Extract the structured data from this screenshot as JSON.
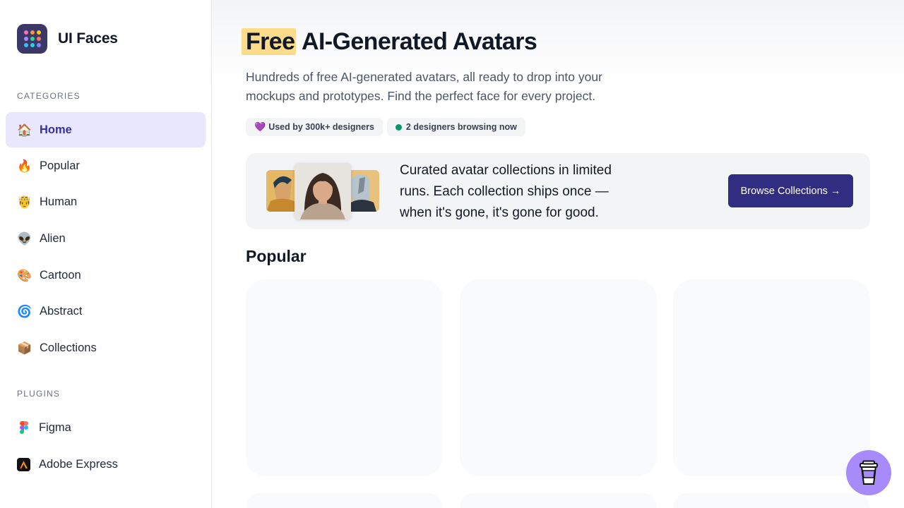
{
  "brand": {
    "name": "UI Faces",
    "logo_dots": [
      "#f472b6",
      "#fb923c",
      "#facc15",
      "#a78bfa",
      "#34d399",
      "#f87171",
      "#38bdf8",
      "#22d3ee",
      "#818cf8"
    ]
  },
  "sidebar": {
    "categories_title": "CATEGORIES",
    "items": [
      {
        "label": "Home",
        "icon": "house-emoji",
        "glyph": "🏠",
        "active": true
      },
      {
        "label": "Popular",
        "icon": "fire-emoji",
        "glyph": "🔥",
        "active": false
      },
      {
        "label": "Human",
        "icon": "face-emoji",
        "glyph": "🤴",
        "active": false
      },
      {
        "label": "Alien",
        "icon": "alien-emoji",
        "glyph": "👽",
        "active": false
      },
      {
        "label": "Cartoon",
        "icon": "palette-emoji",
        "glyph": "🎨",
        "active": false
      },
      {
        "label": "Abstract",
        "icon": "cyclone-emoji",
        "glyph": "🌀",
        "active": false
      },
      {
        "label": "Collections",
        "icon": "package-emoji",
        "glyph": "📦",
        "active": false
      }
    ],
    "plugins_title": "PLUGINS",
    "plugins": [
      {
        "label": "Figma",
        "icon": "figma-icon"
      },
      {
        "label": "Adobe Express",
        "icon": "adobe-express-icon"
      }
    ]
  },
  "hero": {
    "title_highlight": "Free",
    "title_rest": " AI-Generated Avatars",
    "subtitle": "Hundreds of free AI-generated avatars, all ready to drop into your mockups and prototypes. Find the perfect face for every project.",
    "badge_users": "Used by 300k+ designers",
    "badge_browsing": "2 designers browsing now"
  },
  "promo": {
    "text": "Curated avatar collections in limited runs. Each collection ships once — when it's gone, it's gone for good.",
    "button_label": "Browse Collections →"
  },
  "popular": {
    "heading": "Popular"
  },
  "colors": {
    "accent": "#312e81",
    "active_bg": "#e9e7fd",
    "highlight": "#fcdc8a",
    "online": "#059669"
  }
}
